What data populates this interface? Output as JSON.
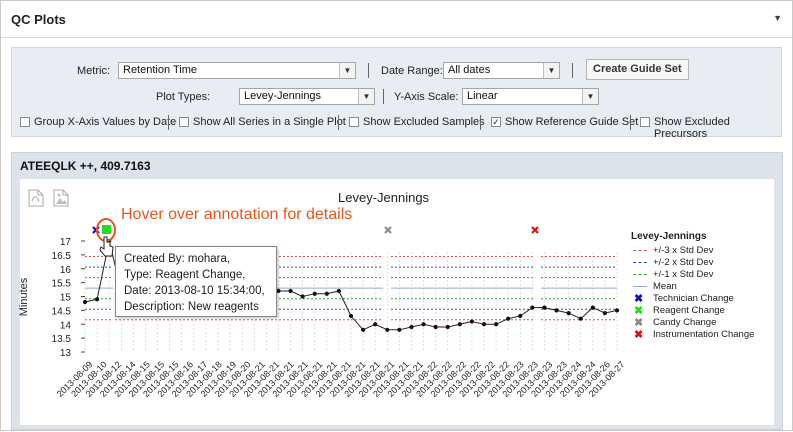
{
  "header": {
    "title": "QC Plots",
    "collapse_icon": "triangle-down-icon"
  },
  "controls": {
    "metric_label": "Metric:",
    "metric_value": "Retention Time",
    "date_range_label": "Date Range:",
    "date_range_value": "All dates",
    "create_guide_set": "Create Guide Set",
    "plot_types_label": "Plot Types:",
    "plot_types_value": "Levey-Jennings",
    "y_axis_label": "Y-Axis Scale:",
    "y_axis_value": "Linear",
    "checkboxes": [
      {
        "label": "Group X-Axis Values by Date",
        "checked": false
      },
      {
        "label": "Show All Series in a Single Plot",
        "checked": false
      },
      {
        "label": "Show Excluded Samples",
        "checked": false
      },
      {
        "label": "Show Reference Guide Set",
        "checked": true
      },
      {
        "label": "Show Excluded Precursors",
        "checked": false
      }
    ]
  },
  "panel": {
    "title": "ATEEQLK ++, 409.7163",
    "pdf_icon": "pdf-export-icon",
    "png_icon": "image-export-icon"
  },
  "annotation_hint": "Hover over annotation for details",
  "tooltip": {
    "created_by": "Created By: mohara,",
    "type": "Type: Reagent Change,",
    "date": "Date: 2013-08-10 15:34:00,",
    "description": "Description: New reagents"
  },
  "colors": {
    "sd3": "#e05050",
    "sd2": "#3050d0",
    "sd1": "#30a030",
    "mean": "#9aa6c6",
    "technician": "#1010c0",
    "reagent": "#22dd22",
    "candy": "#8c8c8c",
    "instrumentation": "#e01010",
    "hint": "#e8561c"
  },
  "chart_data": {
    "type": "line",
    "title": "Levey-Jennings",
    "xlabel": "",
    "ylabel": "Minutes",
    "ylim": [
      13,
      17
    ],
    "yticks": [
      13,
      13.5,
      14,
      14.5,
      15,
      15.5,
      16,
      16.5,
      17
    ],
    "categories": [
      "2013-08-09",
      "2013-08-10",
      "2013-08-12",
      "2013-08-14",
      "2013-08-15",
      "2013-08-15",
      "2013-08-15",
      "2013-08-16",
      "2013-08-17",
      "2013-08-18",
      "2013-08-19",
      "2013-08-20",
      "2013-08-21",
      "2013-08-21",
      "2013-08-21",
      "2013-08-21",
      "2013-08-21",
      "2013-08-21",
      "2013-08-21",
      "2013-08-21",
      "2013-08-21",
      "2013-08-21",
      "2013-08-21",
      "2013-08-21",
      "2013-08-22",
      "2013-08-22",
      "2013-08-22",
      "2013-08-22",
      "2013-08-22",
      "2013-08-22",
      "2013-08-23",
      "2013-08-23",
      "2013-08-23",
      "2013-08-23",
      "2013-08-24",
      "2013-08-24",
      "2013-08-26",
      "2013-08-27"
    ],
    "series": [
      {
        "values": [
          14.8,
          14.9,
          17.0,
          15.2,
          15.2,
          15.1,
          15.1,
          15.0,
          15.0,
          15.0,
          15.0,
          14.9,
          15.1,
          15.0,
          14.9,
          15.1,
          15.2,
          15.2,
          15.0,
          15.1,
          15.1,
          15.2,
          14.3,
          13.8,
          14.0,
          13.8,
          13.8,
          13.9,
          14.0,
          13.9,
          13.9,
          14.0,
          14.1,
          14.0,
          14.0,
          14.2,
          14.3,
          14.6,
          14.6,
          14.5,
          14.4,
          14.2,
          14.6,
          14.4,
          14.5
        ]
      }
    ],
    "legend": {
      "title": "Levey-Jennings",
      "entries": [
        "+/-3 x Std Dev",
        "+/-2 x Std Dev",
        "+/-1 x Std Dev",
        "Mean",
        "Technician Change",
        "Reagent Change",
        "Candy Change",
        "Instrumentation Change"
      ],
      "position": "right"
    }
  }
}
